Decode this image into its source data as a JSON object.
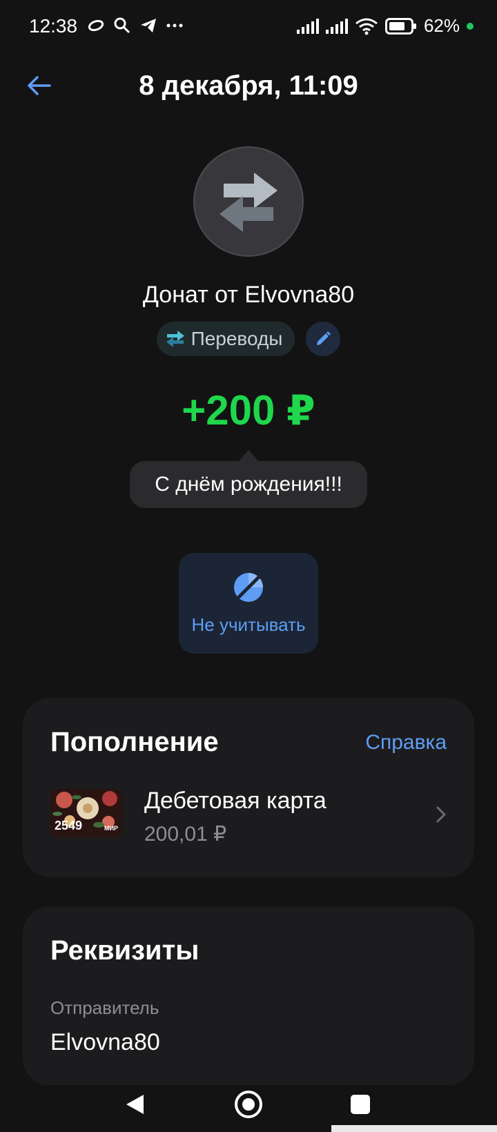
{
  "status_bar": {
    "time": "12:38",
    "battery": "62%",
    "icons": [
      "notification-icon",
      "search-icon",
      "telegram-icon",
      "more-icon",
      "signal-icon",
      "signal-icon",
      "wifi-icon",
      "battery-icon"
    ]
  },
  "header": {
    "title": "8 декабря, 11:09"
  },
  "operation": {
    "name": "Донат от Elvovna80",
    "category": "Переводы",
    "amount": "+200 ₽",
    "message": "С днём рождения!!!",
    "ignore_label": "Не учитывать"
  },
  "topup": {
    "title": "Пополнение",
    "help": "Справка",
    "account": {
      "name": "Дебетовая карта",
      "amount": "200,01 ₽",
      "card_last4": "2549",
      "card_brand": "МИР"
    }
  },
  "requisites": {
    "title": "Реквизиты",
    "sender_label": "Отправитель",
    "sender_value": "Elvovna80"
  },
  "colors": {
    "background": "#131313",
    "card": "#1c1c1e",
    "accent": "#5f9df5",
    "amount": "#1fd64c"
  }
}
